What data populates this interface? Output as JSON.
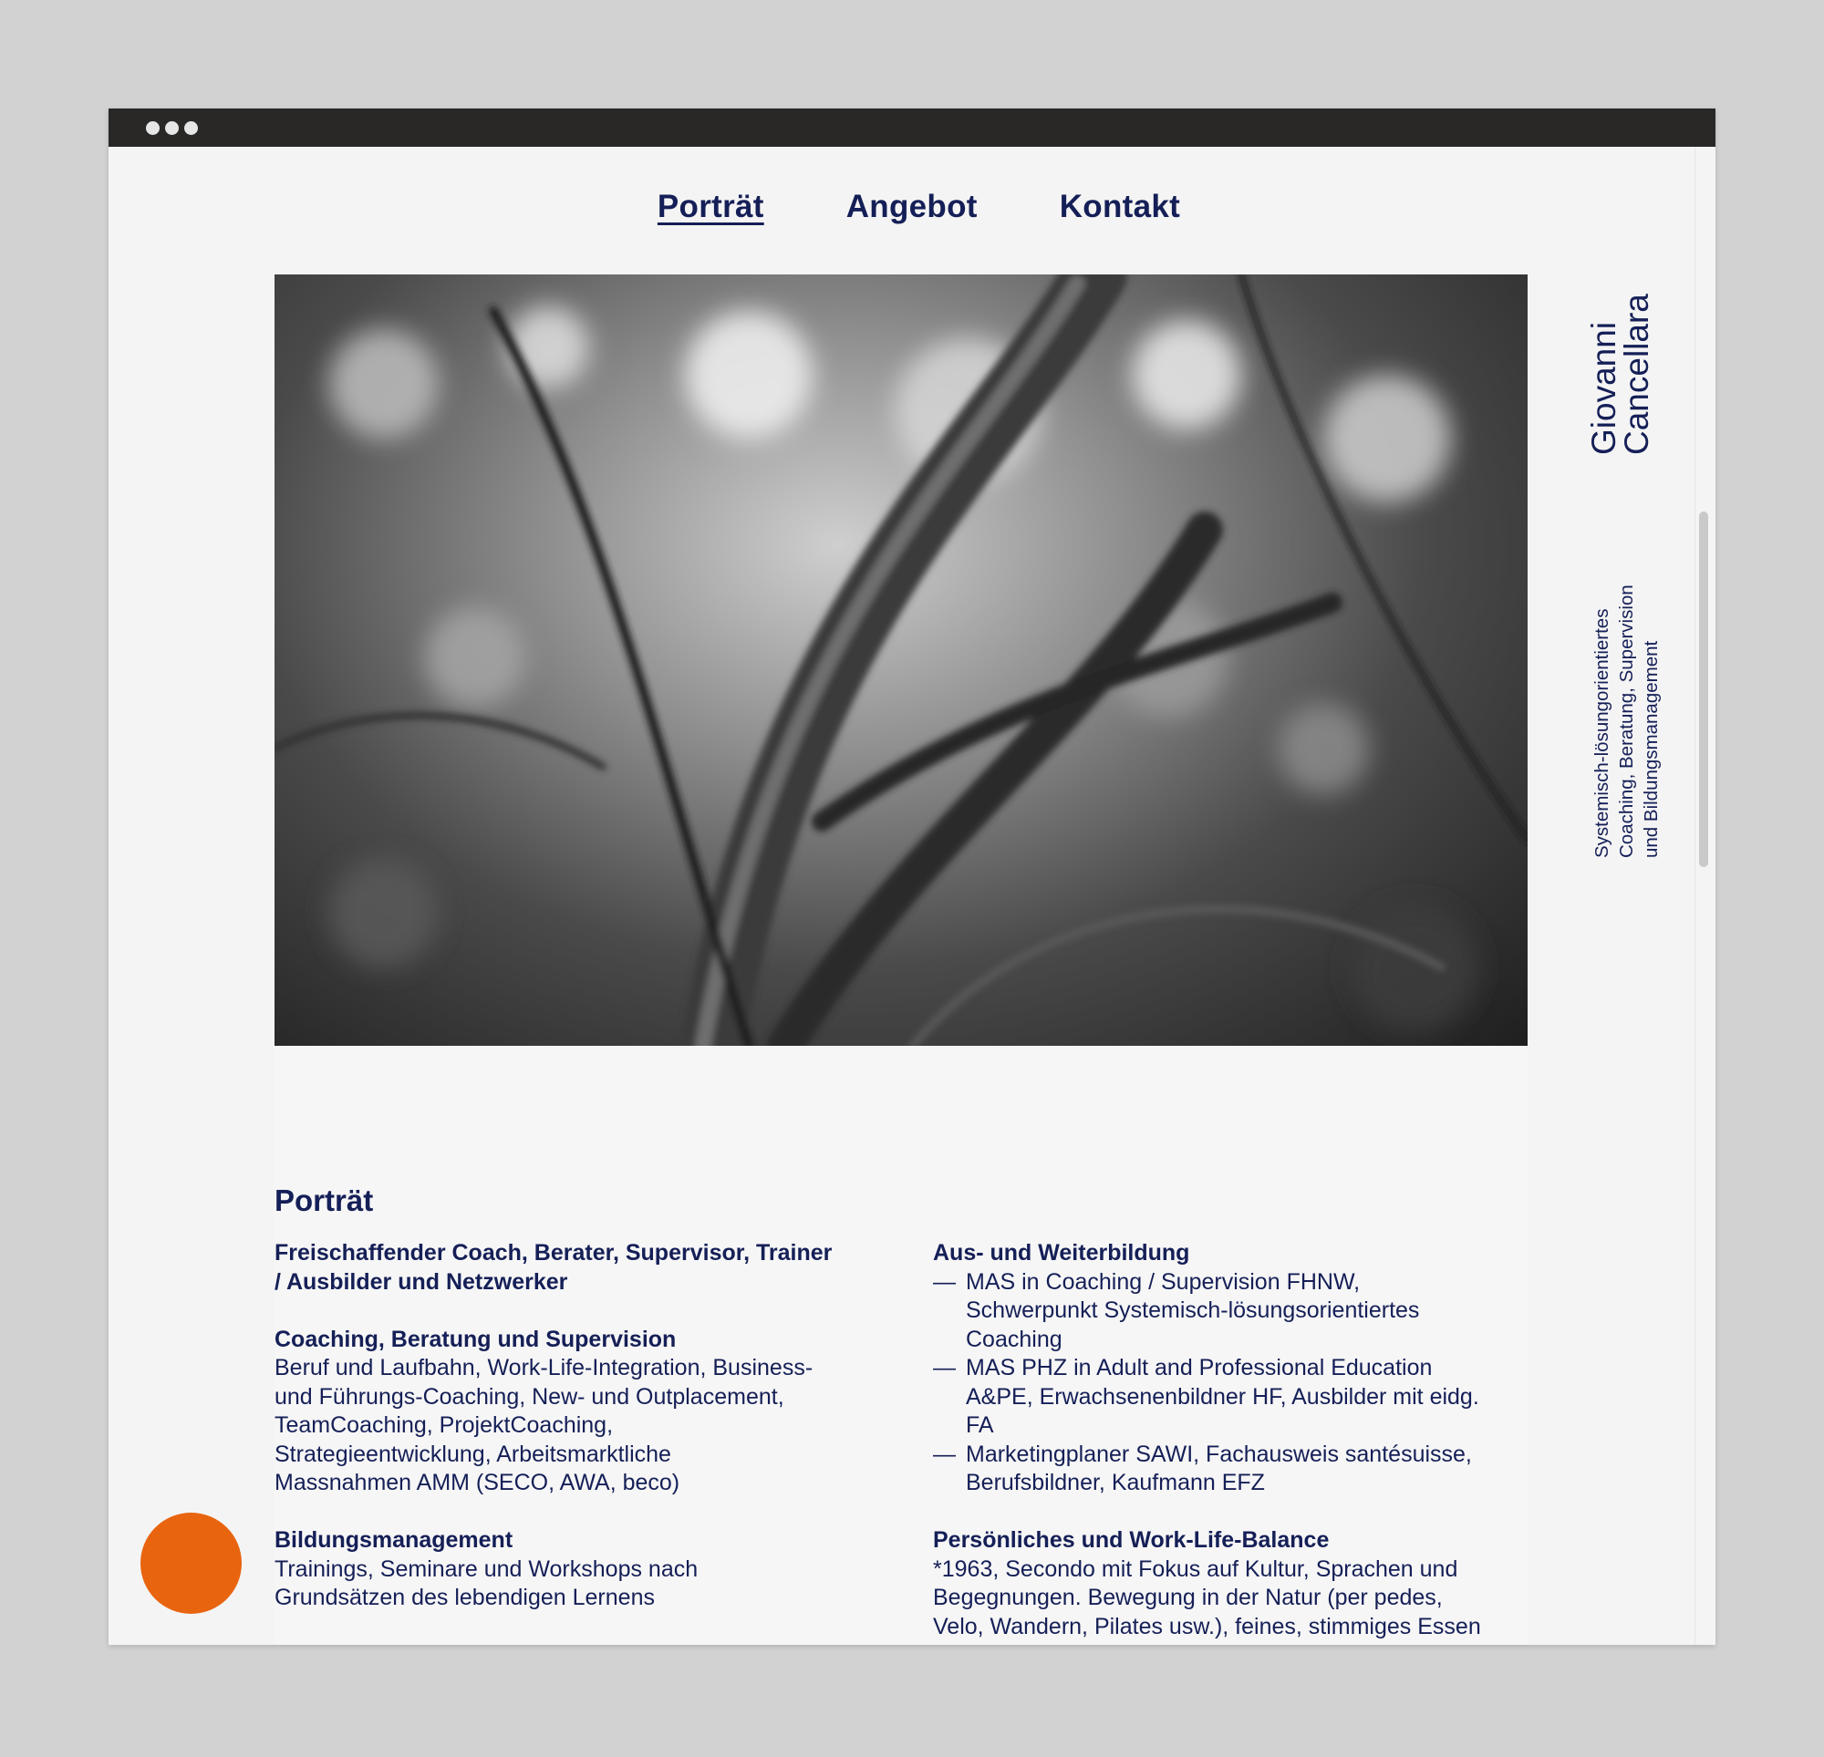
{
  "nav": {
    "items": [
      {
        "label": "Porträt",
        "active": true
      },
      {
        "label": "Angebot",
        "active": false
      },
      {
        "label": "Kontakt",
        "active": false
      }
    ]
  },
  "sidebar": {
    "name_first": "Giovanni",
    "name_last": "Cancellara",
    "tagline": [
      "Systemisch-lösungorientiertes",
      "Coaching, Beratung, Supervision",
      "und Bildungsmanagement"
    ]
  },
  "hero": {
    "image_description_icon": "photo-branches-icon"
  },
  "section": {
    "title": "Porträt",
    "left": {
      "intro": [
        "Freischaffender Coach, Berater, Supervisor, Trainer",
        "/ Ausbilder und Netzwerker"
      ],
      "coaching_heading": "Coaching, Beratung und Supervision",
      "coaching_text": [
        "Beruf und Laufbahn, Work-Life-Integration, Business-",
        "und Führungs-Coaching, New- und Outplacement,",
        "TeamCoaching, ProjektCoaching,",
        "Strategieentwicklung, Arbeitsmarktliche",
        "Massnahmen AMM (SECO, AWA, beco)"
      ],
      "bildung_heading": "Bildungsmanagement",
      "bildung_text": [
        "Trainings, Seminare und Workshops nach",
        "Grundsätzen des lebendigen Lernens"
      ]
    },
    "right": {
      "education_heading": "Aus- und Weiterbildung",
      "dash": "—",
      "education_items": [
        [
          "MAS in Coaching / Supervision FHNW,",
          "Schwerpunkt Systemisch-lösungsorientiertes",
          "Coaching"
        ],
        [
          "MAS PHZ in Adult and Professional Education",
          "A&PE, Erwachsenenbildner HF, Ausbilder mit eidg.",
          "FA"
        ],
        [
          "Marketingplaner SAWI, Fachausweis santésuisse,",
          "Berufsbildner, Kaufmann EFZ"
        ]
      ],
      "personal_heading": "Persönliches und Work-Life-Balance",
      "personal_text": [
        "*1963, Secondo mit Fokus auf Kultur, Sprachen und",
        "Begegnungen. Bewegung in der Natur (per pedes,",
        "Velo, Wandern, Pilates usw.), feines, stimmiges Essen"
      ]
    }
  },
  "colors": {
    "navy": "#151f57",
    "accent_orange": "#e8640f",
    "titlebar": "#2a2827",
    "background": "#f4f4f4"
  }
}
